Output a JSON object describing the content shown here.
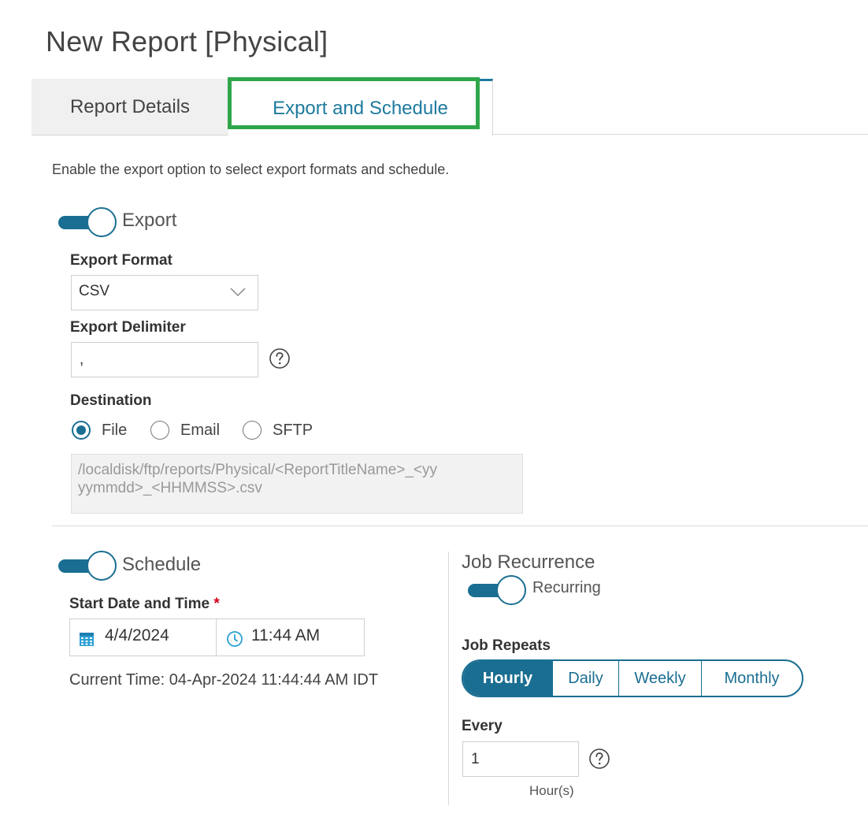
{
  "page": {
    "title": "New Report [Physical]"
  },
  "tabs": [
    {
      "label": "Report Details",
      "active": false
    },
    {
      "label": "Export and Schedule",
      "active": true
    }
  ],
  "intro_text": "Enable the export option to select export formats and schedule.",
  "export": {
    "toggle_label": "Export",
    "enabled": true,
    "format_label": "Export Format",
    "format_value": "CSV",
    "delimiter_label": "Export Delimiter",
    "delimiter_value": ",",
    "destination_label": "Destination",
    "destination_options": [
      {
        "label": "File",
        "checked": true
      },
      {
        "label": "Email",
        "checked": false
      },
      {
        "label": "SFTP",
        "checked": false
      }
    ],
    "path_line1": "/localdisk/ftp/reports/Physical/<ReportTitleName>_<yy",
    "path_line2": "yymmdd>_<HHMMSS>.csv"
  },
  "schedule": {
    "toggle_label": "Schedule",
    "enabled": true,
    "start_label": "Start Date and Time",
    "required_mark": "*",
    "date_value": "4/4/2024",
    "time_value": "11:44 AM",
    "current_time": "Current Time: 04-Apr-2024 11:44:44 AM IDT"
  },
  "recurrence": {
    "title": "Job Recurrence",
    "toggle_label": "Recurring",
    "enabled": true,
    "repeats_label": "Job Repeats",
    "repeat_options": [
      "Hourly",
      "Daily",
      "Weekly",
      "Monthly"
    ],
    "repeat_selected": "Hourly",
    "every_label": "Every",
    "every_value": "1",
    "unit": "Hour(s)"
  },
  "colors": {
    "accent": "#1a6e91",
    "tab_active_text": "#1e7a9e",
    "highlight_box": "#2fa64a",
    "required": "#d0021b"
  },
  "icons": [
    "chevron-down-icon",
    "help-icon",
    "calendar-icon",
    "clock-icon"
  ]
}
